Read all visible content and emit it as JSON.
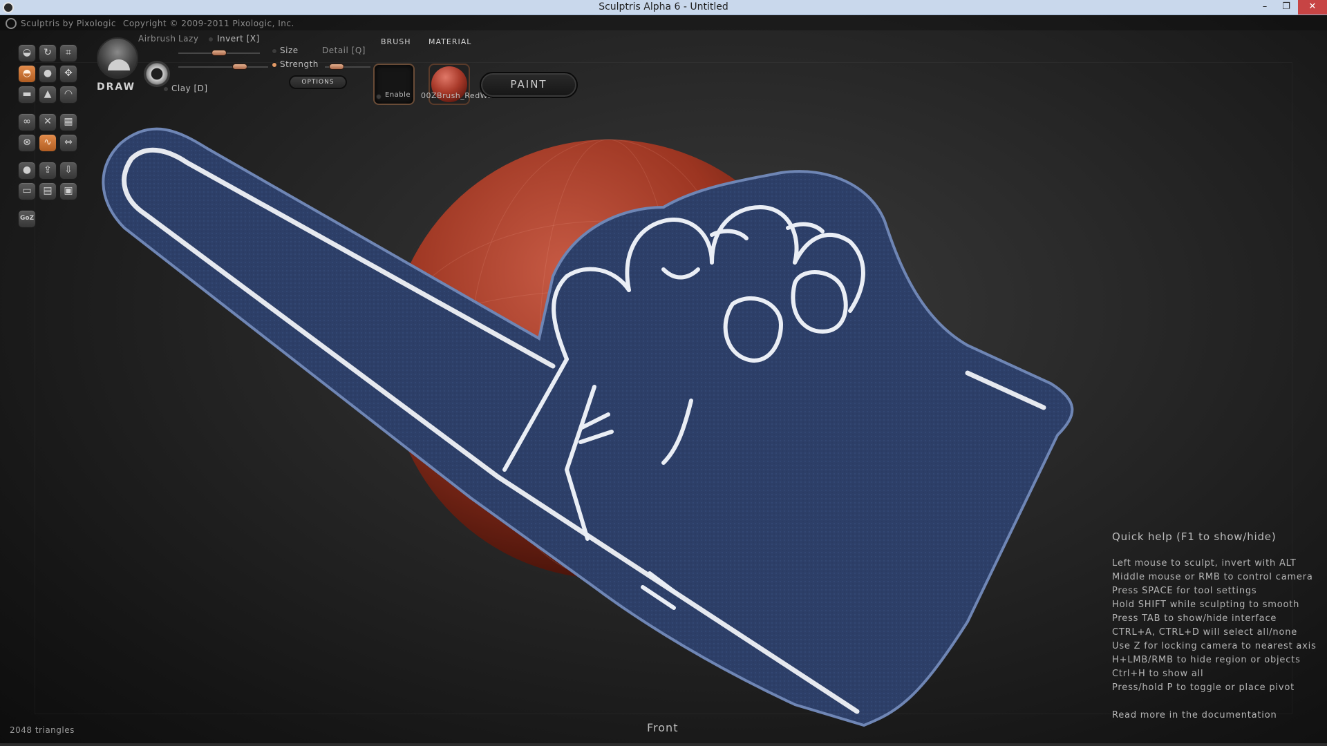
{
  "window": {
    "title": "Sculptris Alpha 6 - Untitled",
    "minimize_glyph": "–",
    "maximize_glyph": "❐",
    "close_glyph": "✕"
  },
  "header": {
    "by": "Sculptris by Pixologic",
    "copyright": "Copyright © 2009-2011 Pixologic, Inc."
  },
  "tools": {
    "current_tool": "DRAW",
    "airbrush_label": "Airbrush",
    "lazy_label": "Lazy",
    "invert_label": "Invert [X]",
    "size_label": "Size",
    "strength_label": "Strength",
    "detail_label": "Detail [Q]",
    "options_label": "OPTIONS",
    "clay_label": "Clay [D]",
    "goz_label": "GoZ"
  },
  "brush": {
    "title": "BRUSH",
    "enable_label": "Enable"
  },
  "material": {
    "title": "MATERIAL",
    "name": "00ZBrush_RedWax",
    "color": "#a93a2a"
  },
  "paint_button": "PAINT",
  "quick_help": {
    "title": "Quick help (F1 to show/hide)",
    "lines": [
      "Left mouse to sculpt, invert with ALT",
      "Middle mouse or RMB to control camera",
      "Press SPACE for tool settings",
      "Hold SHIFT while sculpting to smooth",
      "Press TAB to show/hide interface",
      "CTRL+A, CTRL+D will select all/none",
      "Use Z for locking camera to nearest axis",
      "H+LMB/RMB to hide region or objects",
      "Ctrl+H to show all",
      "Press/hold P to toggle or place pivot"
    ],
    "doc_link": "Read more in the documentation"
  },
  "status": {
    "triangles": "2048 triangles",
    "view": "Front"
  },
  "colors": {
    "accent": "#d4783a",
    "foam_finger": "#2c3e66",
    "sphere": "#a93a2a"
  }
}
